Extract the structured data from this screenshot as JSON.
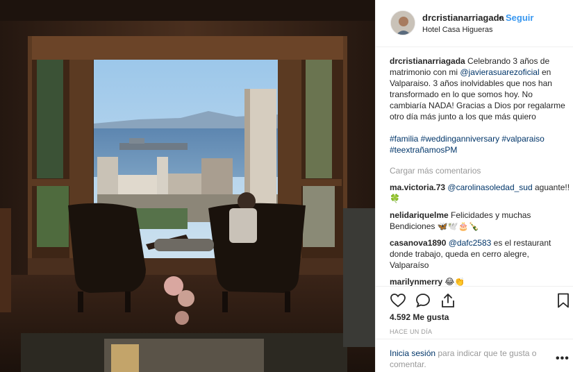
{
  "post": {
    "username": "drcristianarriagada",
    "separator": "•",
    "follow_label": "Seguir",
    "location": "Hotel Casa Higueras"
  },
  "caption": {
    "username": "drcristianarriagada",
    "text_part1": " Celebrando 3 años de matrimonio con mi ",
    "mention": "@javierasuarezoficial",
    "text_part2": " en Valparaiso. 3 años inolvidables que nos han transformado en lo que somos hoy. No cambiaría NADA! Gracias a Dios por regalarme otro día más junto a los que más quiero",
    "hashtags": "#familia #weddinganniversary #valparaiso #teextrañamosPM"
  },
  "load_more_label": "Cargar más comentarios",
  "comments": [
    {
      "username": "ma.victoria.73",
      "mention": "@carolinasoledad_sud",
      "text": " aguante!!🍀"
    },
    {
      "username": "nelidariquelme",
      "mention": "",
      "text": " Felicidades y muchas Bendiciones 🦋🕊️🎂🍾"
    },
    {
      "username": "casanova1890",
      "mention": "@dafc2583",
      "text": " es el restaurant donde trabajo, queda en cerro alegre, Valparaíso"
    },
    {
      "username": "marilynmerry",
      "mention": "",
      "text": " 😂👏"
    }
  ],
  "likes_label": "4.592 Me gusta",
  "timestamp": "HACE UN DÍA",
  "login": {
    "link": "Inicia sesión",
    "text": " para indicar que te gusta o comentar."
  },
  "more_label": "•••",
  "icons": [
    "heart-icon",
    "comment-icon",
    "share-icon",
    "bookmark-icon"
  ],
  "colors": {
    "link_blue": "#3897f0",
    "mention_blue": "#003569",
    "muted": "#999999"
  }
}
